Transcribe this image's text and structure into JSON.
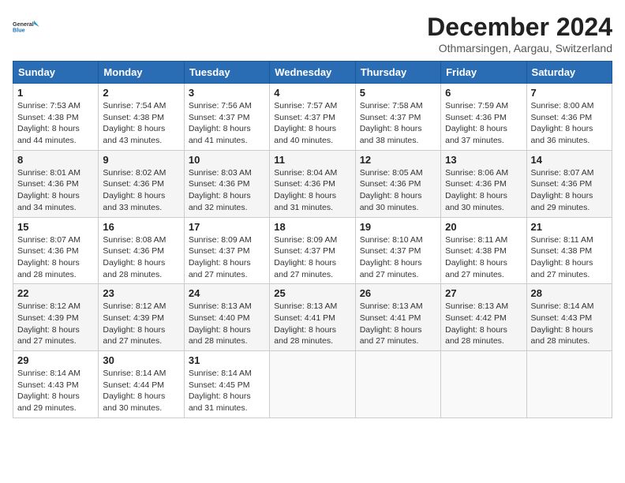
{
  "header": {
    "logo_line1": "General",
    "logo_line2": "Blue",
    "month_title": "December 2024",
    "location": "Othmarsingen, Aargau, Switzerland"
  },
  "weekdays": [
    "Sunday",
    "Monday",
    "Tuesday",
    "Wednesday",
    "Thursday",
    "Friday",
    "Saturday"
  ],
  "weeks": [
    [
      {
        "day": "1",
        "info": "Sunrise: 7:53 AM\nSunset: 4:38 PM\nDaylight: 8 hours\nand 44 minutes."
      },
      {
        "day": "2",
        "info": "Sunrise: 7:54 AM\nSunset: 4:38 PM\nDaylight: 8 hours\nand 43 minutes."
      },
      {
        "day": "3",
        "info": "Sunrise: 7:56 AM\nSunset: 4:37 PM\nDaylight: 8 hours\nand 41 minutes."
      },
      {
        "day": "4",
        "info": "Sunrise: 7:57 AM\nSunset: 4:37 PM\nDaylight: 8 hours\nand 40 minutes."
      },
      {
        "day": "5",
        "info": "Sunrise: 7:58 AM\nSunset: 4:37 PM\nDaylight: 8 hours\nand 38 minutes."
      },
      {
        "day": "6",
        "info": "Sunrise: 7:59 AM\nSunset: 4:36 PM\nDaylight: 8 hours\nand 37 minutes."
      },
      {
        "day": "7",
        "info": "Sunrise: 8:00 AM\nSunset: 4:36 PM\nDaylight: 8 hours\nand 36 minutes."
      }
    ],
    [
      {
        "day": "8",
        "info": "Sunrise: 8:01 AM\nSunset: 4:36 PM\nDaylight: 8 hours\nand 34 minutes."
      },
      {
        "day": "9",
        "info": "Sunrise: 8:02 AM\nSunset: 4:36 PM\nDaylight: 8 hours\nand 33 minutes."
      },
      {
        "day": "10",
        "info": "Sunrise: 8:03 AM\nSunset: 4:36 PM\nDaylight: 8 hours\nand 32 minutes."
      },
      {
        "day": "11",
        "info": "Sunrise: 8:04 AM\nSunset: 4:36 PM\nDaylight: 8 hours\nand 31 minutes."
      },
      {
        "day": "12",
        "info": "Sunrise: 8:05 AM\nSunset: 4:36 PM\nDaylight: 8 hours\nand 30 minutes."
      },
      {
        "day": "13",
        "info": "Sunrise: 8:06 AM\nSunset: 4:36 PM\nDaylight: 8 hours\nand 30 minutes."
      },
      {
        "day": "14",
        "info": "Sunrise: 8:07 AM\nSunset: 4:36 PM\nDaylight: 8 hours\nand 29 minutes."
      }
    ],
    [
      {
        "day": "15",
        "info": "Sunrise: 8:07 AM\nSunset: 4:36 PM\nDaylight: 8 hours\nand 28 minutes."
      },
      {
        "day": "16",
        "info": "Sunrise: 8:08 AM\nSunset: 4:36 PM\nDaylight: 8 hours\nand 28 minutes."
      },
      {
        "day": "17",
        "info": "Sunrise: 8:09 AM\nSunset: 4:37 PM\nDaylight: 8 hours\nand 27 minutes."
      },
      {
        "day": "18",
        "info": "Sunrise: 8:09 AM\nSunset: 4:37 PM\nDaylight: 8 hours\nand 27 minutes."
      },
      {
        "day": "19",
        "info": "Sunrise: 8:10 AM\nSunset: 4:37 PM\nDaylight: 8 hours\nand 27 minutes."
      },
      {
        "day": "20",
        "info": "Sunrise: 8:11 AM\nSunset: 4:38 PM\nDaylight: 8 hours\nand 27 minutes."
      },
      {
        "day": "21",
        "info": "Sunrise: 8:11 AM\nSunset: 4:38 PM\nDaylight: 8 hours\nand 27 minutes."
      }
    ],
    [
      {
        "day": "22",
        "info": "Sunrise: 8:12 AM\nSunset: 4:39 PM\nDaylight: 8 hours\nand 27 minutes."
      },
      {
        "day": "23",
        "info": "Sunrise: 8:12 AM\nSunset: 4:39 PM\nDaylight: 8 hours\nand 27 minutes."
      },
      {
        "day": "24",
        "info": "Sunrise: 8:13 AM\nSunset: 4:40 PM\nDaylight: 8 hours\nand 28 minutes."
      },
      {
        "day": "25",
        "info": "Sunrise: 8:13 AM\nSunset: 4:41 PM\nDaylight: 8 hours\nand 28 minutes."
      },
      {
        "day": "26",
        "info": "Sunrise: 8:13 AM\nSunset: 4:41 PM\nDaylight: 8 hours\nand 27 minutes."
      },
      {
        "day": "27",
        "info": "Sunrise: 8:13 AM\nSunset: 4:42 PM\nDaylight: 8 hours\nand 28 minutes."
      },
      {
        "day": "28",
        "info": "Sunrise: 8:14 AM\nSunset: 4:43 PM\nDaylight: 8 hours\nand 28 minutes."
      }
    ],
    [
      {
        "day": "29",
        "info": "Sunrise: 8:14 AM\nSunset: 4:43 PM\nDaylight: 8 hours\nand 29 minutes."
      },
      {
        "day": "30",
        "info": "Sunrise: 8:14 AM\nSunset: 4:44 PM\nDaylight: 8 hours\nand 30 minutes."
      },
      {
        "day": "31",
        "info": "Sunrise: 8:14 AM\nSunset: 4:45 PM\nDaylight: 8 hours\nand 31 minutes."
      },
      null,
      null,
      null,
      null
    ]
  ]
}
